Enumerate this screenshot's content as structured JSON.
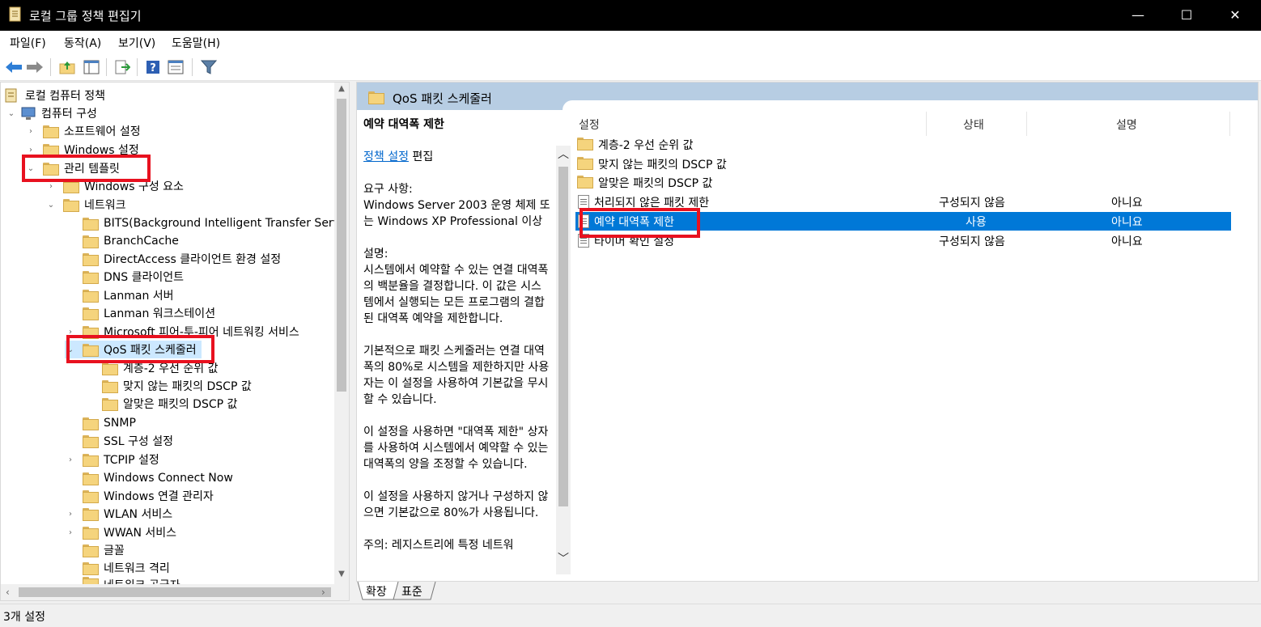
{
  "window": {
    "title": "로컬 그룹 정책 편집기",
    "minimize": "—",
    "maximize": "☐",
    "close": "✕"
  },
  "menu": [
    "파일(F)",
    "동작(A)",
    "보기(V)",
    "도움말(H)"
  ],
  "toolbar": {
    "icons": [
      "back-icon",
      "forward-icon",
      "up-folder-icon",
      "show-hide-tree-icon",
      "export-list-icon",
      "help-icon",
      "properties-icon",
      "filter-icon"
    ]
  },
  "tree": {
    "items": [
      {
        "label": "로컬 컴퓨터 정책",
        "chevron": ""
      },
      {
        "label": "컴퓨터 구성",
        "chevron": "⌄"
      },
      {
        "label": "소프트웨어 설정",
        "chevron": "›"
      },
      {
        "label": "Windows 설정",
        "chevron": "›"
      },
      {
        "label": "관리 템플릿",
        "chevron": "⌄"
      },
      {
        "label": "Windows 구성 요소",
        "chevron": "›"
      },
      {
        "label": "네트워크",
        "chevron": "⌄"
      },
      {
        "label": "BITS(Background Intelligent Transfer Service)",
        "chevron": ""
      },
      {
        "label": "BranchCache",
        "chevron": ""
      },
      {
        "label": "DirectAccess 클라이언트 환경 설정",
        "chevron": ""
      },
      {
        "label": "DNS 클라이언트",
        "chevron": ""
      },
      {
        "label": "Lanman 서버",
        "chevron": ""
      },
      {
        "label": "Lanman 워크스테이션",
        "chevron": ""
      },
      {
        "label": "Microsoft 피어-투-피어 네트워킹 서비스",
        "chevron": "›"
      },
      {
        "label": "QoS 패킷 스케줄러",
        "chevron": "⌄"
      },
      {
        "label": "계층-2 우선 순위 값",
        "chevron": ""
      },
      {
        "label": "맞지 않는 패킷의 DSCP 값",
        "chevron": ""
      },
      {
        "label": "알맞은 패킷의 DSCP 값",
        "chevron": ""
      },
      {
        "label": "SNMP",
        "chevron": ""
      },
      {
        "label": "SSL 구성 설정",
        "chevron": ""
      },
      {
        "label": "TCPIP 설정",
        "chevron": "›"
      },
      {
        "label": "Windows Connect Now",
        "chevron": ""
      },
      {
        "label": "Windows 연결 관리자",
        "chevron": ""
      },
      {
        "label": "WLAN 서비스",
        "chevron": "›"
      },
      {
        "label": "WWAN 서비스",
        "chevron": "›"
      },
      {
        "label": "글꼴",
        "chevron": ""
      },
      {
        "label": "네트워크 격리",
        "chevron": ""
      },
      {
        "label": "네트워크 공급자",
        "chevron": ""
      }
    ]
  },
  "detail": {
    "header": "QoS 패킷 스케줄러",
    "description": {
      "title": "예약 대역폭 제한",
      "link": "정책 설정",
      "link_suffix": " 편집",
      "requirements_label": "요구 사항:",
      "requirements": "Windows Server 2003 운영 체제 또는 Windows XP Professional 이상",
      "description_label": "설명:",
      "p1": "시스템에서 예약할 수 있는 연결 대역폭의 백분율을 결정합니다. 이 값은 시스템에서 실행되는 모든 프로그램의 결합된 대역폭 예약을 제한합니다.",
      "p2": "기본적으로 패킷 스케줄러는 연결 대역폭의 80%로 시스템을 제한하지만 사용자는 이 설정을 사용하여 기본값을 무시할 수 있습니다.",
      "p3": "이 설정을 사용하면 \"대역폭 제한\" 상자를 사용하여 시스템에서 예약할 수 있는 대역폭의 양을 조정할 수 있습니다.",
      "p4": "이 설정을 사용하지 않거나 구성하지 않으면 기본값으로 80%가 사용됩니다.",
      "p5": "주의: 레지스트리에 특정 네트워"
    },
    "columns": [
      "설정",
      "상태",
      "설명"
    ],
    "rows": [
      {
        "name": "계층-2 우선 순위 값",
        "type": "folder",
        "state": "",
        "comment": ""
      },
      {
        "name": "맞지 않는 패킷의 DSCP 값",
        "type": "folder",
        "state": "",
        "comment": ""
      },
      {
        "name": "알맞은 패킷의 DSCP 값",
        "type": "folder",
        "state": "",
        "comment": ""
      },
      {
        "name": "처리되지 않은 패킷 제한",
        "type": "policy",
        "state": "구성되지 않음",
        "comment": "아니요"
      },
      {
        "name": "예약 대역폭 제한",
        "type": "policy",
        "state": "사용",
        "comment": "아니요"
      },
      {
        "name": "타이머 확인 설정",
        "type": "policy",
        "state": "구성되지 않음",
        "comment": "아니요"
      }
    ],
    "tabs": [
      "확장",
      "표준"
    ]
  },
  "status": "3개 설정",
  "colors": {
    "selection": "#0078d7",
    "highlight_box": "#e8111f",
    "header_band": "#b7cde3"
  }
}
